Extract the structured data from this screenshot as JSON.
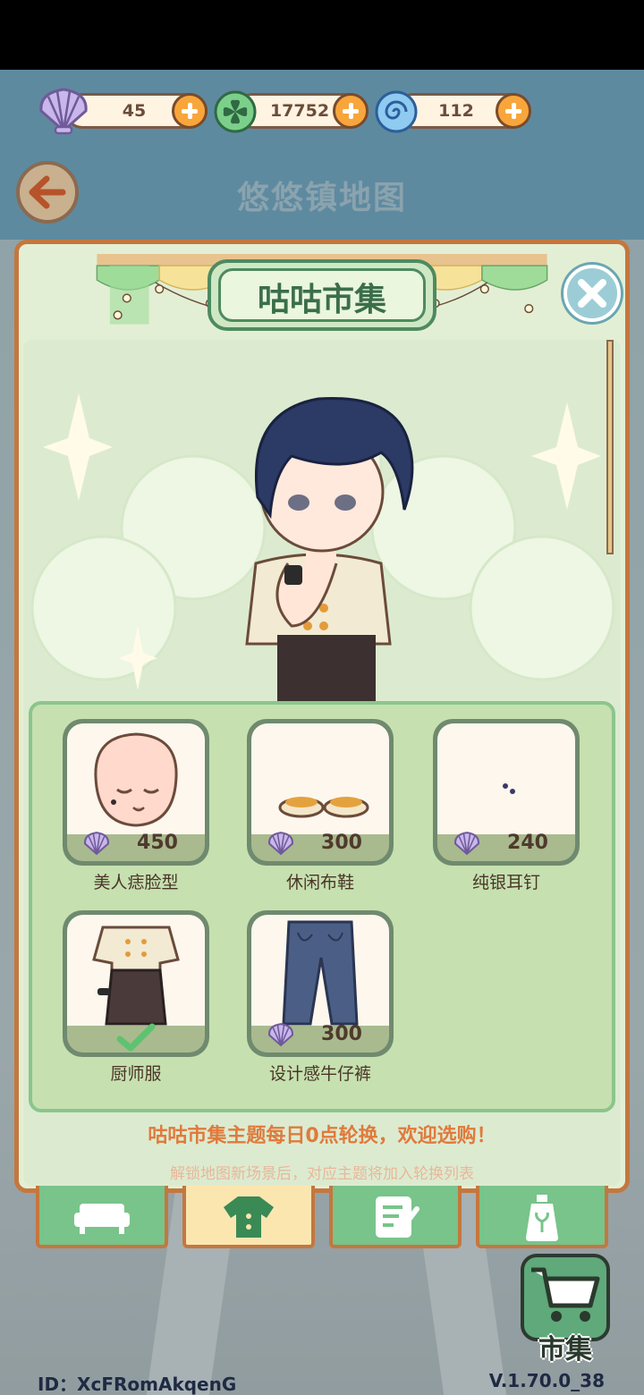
{
  "currencies": [
    {
      "icon": "shell-icon",
      "value": "45"
    },
    {
      "icon": "clover-coin-icon",
      "value": "17752"
    },
    {
      "icon": "swirl-gem-icon",
      "value": "112"
    }
  ],
  "header": {
    "title": "悠悠镇地图"
  },
  "market": {
    "title": "咕咕市集"
  },
  "items": [
    {
      "label": "美人痣脸型",
      "price": "450",
      "owned": false
    },
    {
      "label": "休闲布鞋",
      "price": "300",
      "owned": false
    },
    {
      "label": "纯银耳钉",
      "price": "240",
      "owned": false
    },
    {
      "label": "厨师服",
      "price": "",
      "owned": true
    },
    {
      "label": "设计感牛仔裤",
      "price": "300",
      "owned": false
    }
  ],
  "notices": {
    "primary": "咕咕市集主题每日0点轮换，欢迎选购！",
    "secondary": "解锁地图新场景后，对应主题将加入轮换列表"
  },
  "tabs": [
    {
      "icon": "sofa-icon",
      "active": false
    },
    {
      "icon": "shirt-icon",
      "active": true
    },
    {
      "icon": "note-icon",
      "active": false
    },
    {
      "icon": "bottle-icon",
      "active": false
    }
  ],
  "market_button": {
    "label": "市集",
    "icon": "cart-icon"
  },
  "footer": {
    "id": "ID：XcFRomAkqenG",
    "version": "V.1.70.0_38"
  },
  "colors": {
    "panel_border": "#c4773e",
    "accent_green": "#78c48a",
    "price_text": "#4f3a2c",
    "notice": "#e07a3c"
  }
}
